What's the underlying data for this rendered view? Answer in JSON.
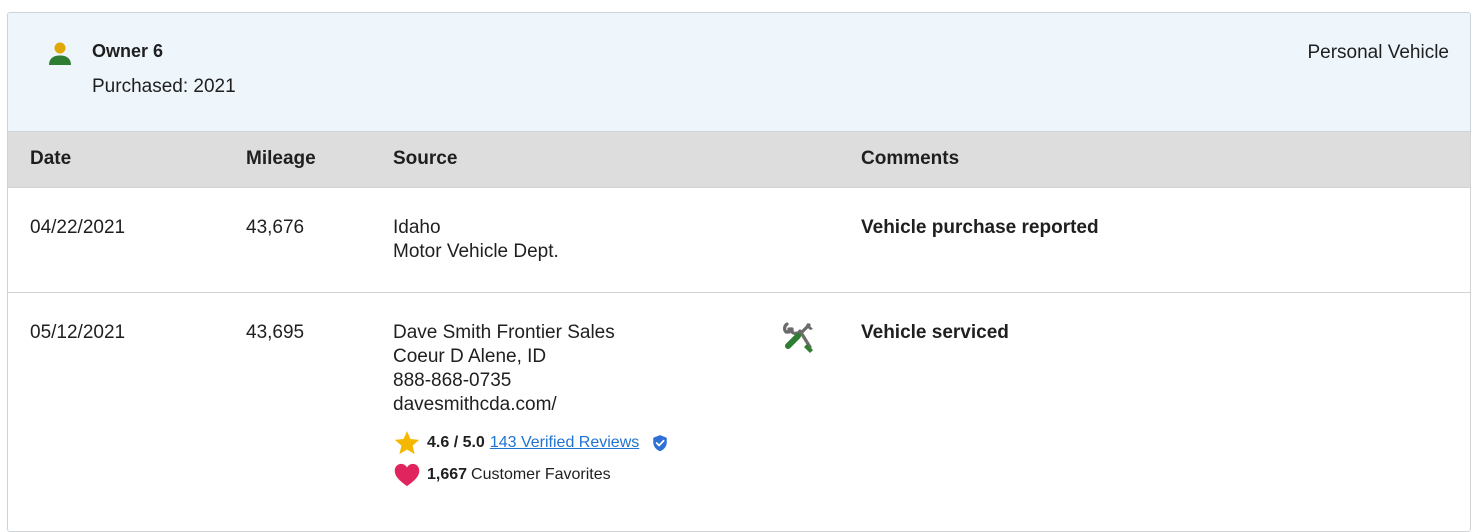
{
  "owner": {
    "name": "Owner 6",
    "purchased": "Purchased: 2021",
    "vehicle_type": "Personal Vehicle",
    "icon": "person-icon"
  },
  "columns": {
    "date": "Date",
    "mileage": "Mileage",
    "source": "Source",
    "comments": "Comments"
  },
  "records": [
    {
      "date": "04/22/2021",
      "mileage": "43,676",
      "source": [
        "Idaho",
        "Motor Vehicle Dept."
      ],
      "comment": "Vehicle purchase reported"
    },
    {
      "date": "05/12/2021",
      "mileage": "43,695",
      "source": [
        "Dave Smith Frontier Sales",
        "Coeur D Alene, ID",
        "888-868-0735",
        "davesmithcda.com/"
      ],
      "comment": "Vehicle serviced",
      "icon": "tools-icon",
      "rating": "4.6 / 5.0",
      "reviews_link": "143 Verified Reviews",
      "favorites_count": "1,667",
      "favorites_label": "Customer Favorites"
    }
  ],
  "colors": {
    "header_bg": "#eef5fb",
    "column_header_bg": "#dddddd",
    "person_head": "#e0a800",
    "person_body": "#2e7d32",
    "star": "#f5b800",
    "heart": "#e0245e",
    "link": "#1f73d1",
    "shield": "#2f6fd6"
  }
}
